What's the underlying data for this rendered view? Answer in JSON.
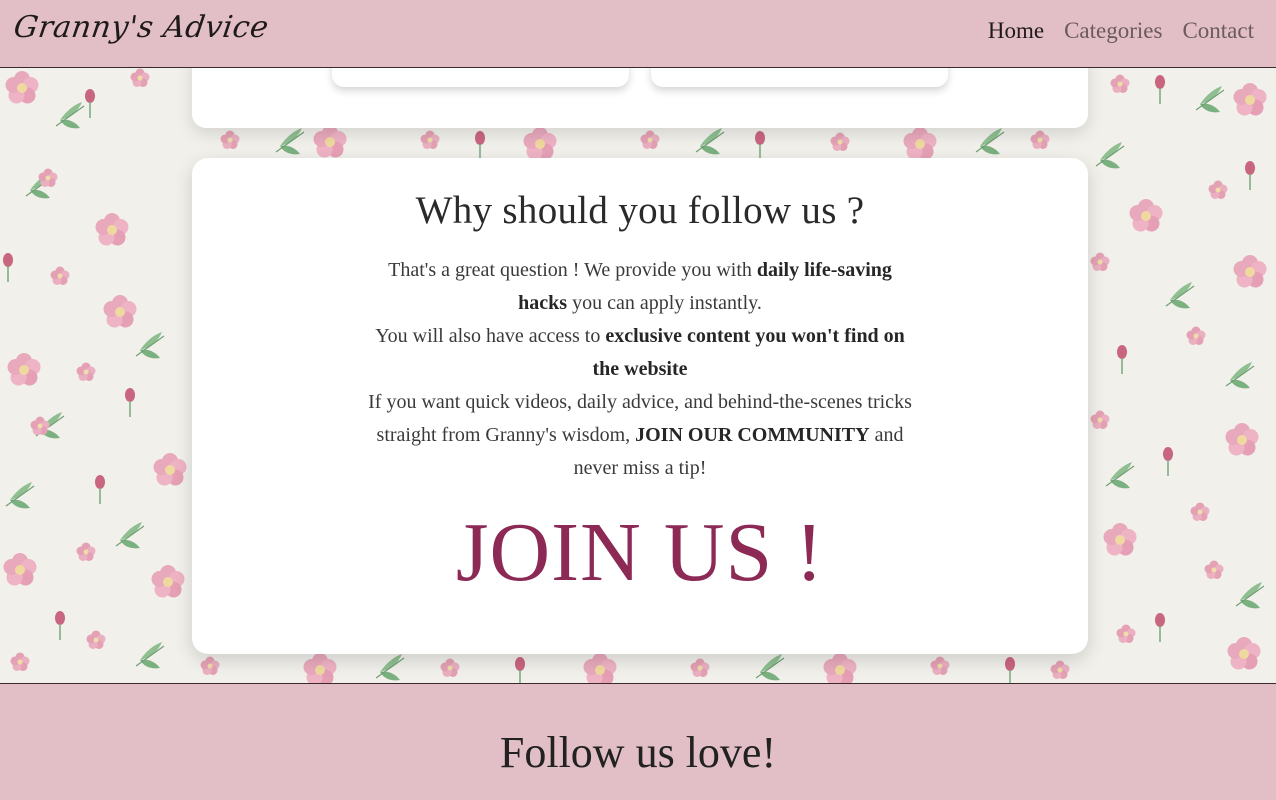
{
  "navbar": {
    "brand": "Granny's Advice",
    "links": [
      {
        "label": "Home"
      },
      {
        "label": "Categories"
      },
      {
        "label": "Contact"
      }
    ]
  },
  "follow_section": {
    "title": "Why should you follow us ?",
    "p1_a": "That's a great question ! We provide you with ",
    "p1_b": "daily life-saving hacks",
    "p1_c": " you can apply instantly.",
    "p2_a": "You will also have access to ",
    "p2_b": "exclusive content you won't find on the website",
    "p3_a": "If you want quick videos, daily advice, and behind-the-scenes tricks straight from Granny's wisdom, ",
    "p3_b": "JOIN OUR COMMUNITY",
    "p3_c": " and never miss a tip!",
    "join_label": "JOIN US !"
  },
  "footer": {
    "title": "Follow us love!"
  },
  "colors": {
    "nav_bg": "#e2bfc6",
    "accent": "#8c2a55",
    "page_bg": "#f1f0eb"
  }
}
